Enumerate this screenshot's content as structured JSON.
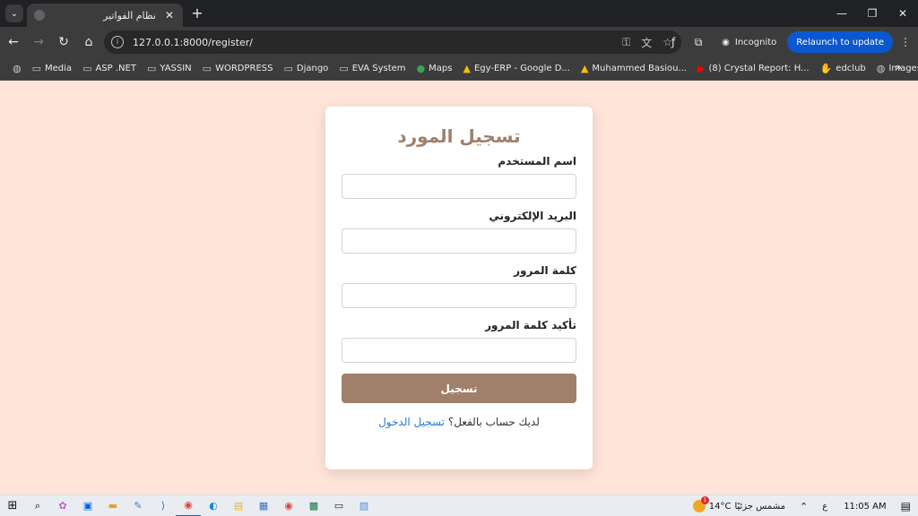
{
  "browser": {
    "tab_title": "نظام الفواتير",
    "url": "127.0.0.1:8000/register/",
    "incognito_label": "Incognito",
    "relaunch_label": "Relaunch to update",
    "bookmarks": [
      {
        "label": "Media",
        "icon": "folder-icon"
      },
      {
        "label": "ASP .NET",
        "icon": "folder-icon"
      },
      {
        "label": "YASSIN",
        "icon": "folder-icon"
      },
      {
        "label": "WORDPRESS",
        "icon": "folder-icon"
      },
      {
        "label": "Django",
        "icon": "folder-icon"
      },
      {
        "label": "EVA System",
        "icon": "folder-icon"
      },
      {
        "label": "Maps",
        "icon": "maps-icon"
      },
      {
        "label": "Egy-ERP - Google D...",
        "icon": "drive-icon"
      },
      {
        "label": "Muhammed Basiou...",
        "icon": "drive-icon"
      },
      {
        "label": "(8) Crystal Report: H...",
        "icon": "youtube-icon"
      },
      {
        "label": "edclub",
        "icon": "edclub-icon"
      },
      {
        "label": "Images",
        "icon": "globe-icon"
      }
    ]
  },
  "form": {
    "title": "تسجيل المورد",
    "fields": [
      {
        "label": "اسم المستخدم",
        "value": ""
      },
      {
        "label": "البريد الإلكتروني",
        "value": ""
      },
      {
        "label": "كلمة المرور",
        "value": ""
      },
      {
        "label": "تأكيد كلمة المرور",
        "value": ""
      }
    ],
    "submit_label": "تسجيل",
    "login_prompt": "لديك حساب بالفعل؟",
    "login_link": "تسجيل الدخول"
  },
  "taskbar": {
    "weather_temp": "14°C",
    "weather_text": "مشمس جزئيًا",
    "weather_badge": "1",
    "lang": "ع",
    "time": "11:05 AM"
  },
  "colors": {
    "page_background": "#ffe4da",
    "accent": "#a0806b",
    "link": "#1f7ad9"
  }
}
